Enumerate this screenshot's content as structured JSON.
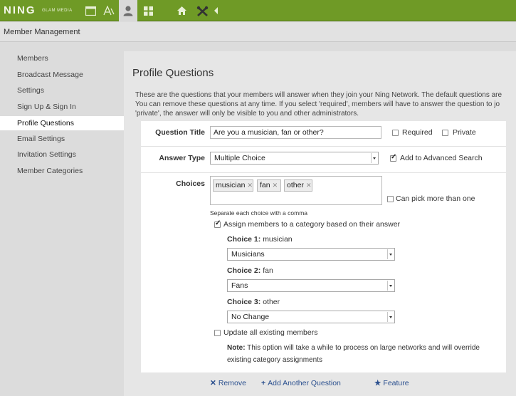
{
  "topbar": {
    "logo": "NING",
    "network_name": "GLAM MEDIA",
    "icons": [
      "window-icon",
      "appearance-icon",
      "members-icon",
      "apps-icon",
      "home-icon",
      "tools-icon",
      "collapse-arrow-icon"
    ],
    "accent_color": "#6f9a26"
  },
  "header": {
    "title": "Member Management"
  },
  "sidebar": {
    "items": [
      {
        "label": "Members"
      },
      {
        "label": "Broadcast Message"
      },
      {
        "label": "Settings"
      },
      {
        "label": "Sign Up & Sign In"
      },
      {
        "label": "Profile Questions",
        "active": true
      },
      {
        "label": "Email Settings"
      },
      {
        "label": "Invitation Settings"
      },
      {
        "label": "Member Categories"
      }
    ]
  },
  "main": {
    "title": "Profile Questions",
    "intro_lines": [
      "These are the questions that your members will answer when they join your Ning Network. The default questions are",
      "You can remove these questions at any time. If you select 'required', members will have to answer the question to jo",
      "'private', the answer will only be visible to you and other administrators."
    ]
  },
  "form": {
    "question_title_label": "Question Title",
    "question_title_value": "Are you a musician, fan or other?",
    "required_label": "Required",
    "required_checked": false,
    "private_label": "Private",
    "private_checked": false,
    "answer_type_label": "Answer Type",
    "answer_type_value": "Multiple Choice",
    "advanced_search_label": "Add to Advanced Search",
    "advanced_search_checked": true,
    "choices_label": "Choices",
    "choices": [
      "musician",
      "fan",
      "other"
    ],
    "choices_hint": "Separate each choice with a comma",
    "pick_more_label": "Can pick more than one",
    "pick_more_checked": false,
    "assign_label": "Assign members to a category based on their answer",
    "assign_checked": true,
    "choice_assignments": [
      {
        "label": "Choice 1:",
        "choice": "musician",
        "category": "Musicians"
      },
      {
        "label": "Choice 2:",
        "choice": "fan",
        "category": "Fans"
      },
      {
        "label": "Choice 3:",
        "choice": "other",
        "category": "No Change"
      }
    ],
    "update_existing_label": "Update all existing members",
    "update_existing_checked": false,
    "note_label": "Note:",
    "note_text": "This option will take a while to process on large networks and will override existing category assignments"
  },
  "actions": {
    "remove_label": "Remove",
    "add_label": "Add Another Question",
    "feature_label": "Feature"
  }
}
